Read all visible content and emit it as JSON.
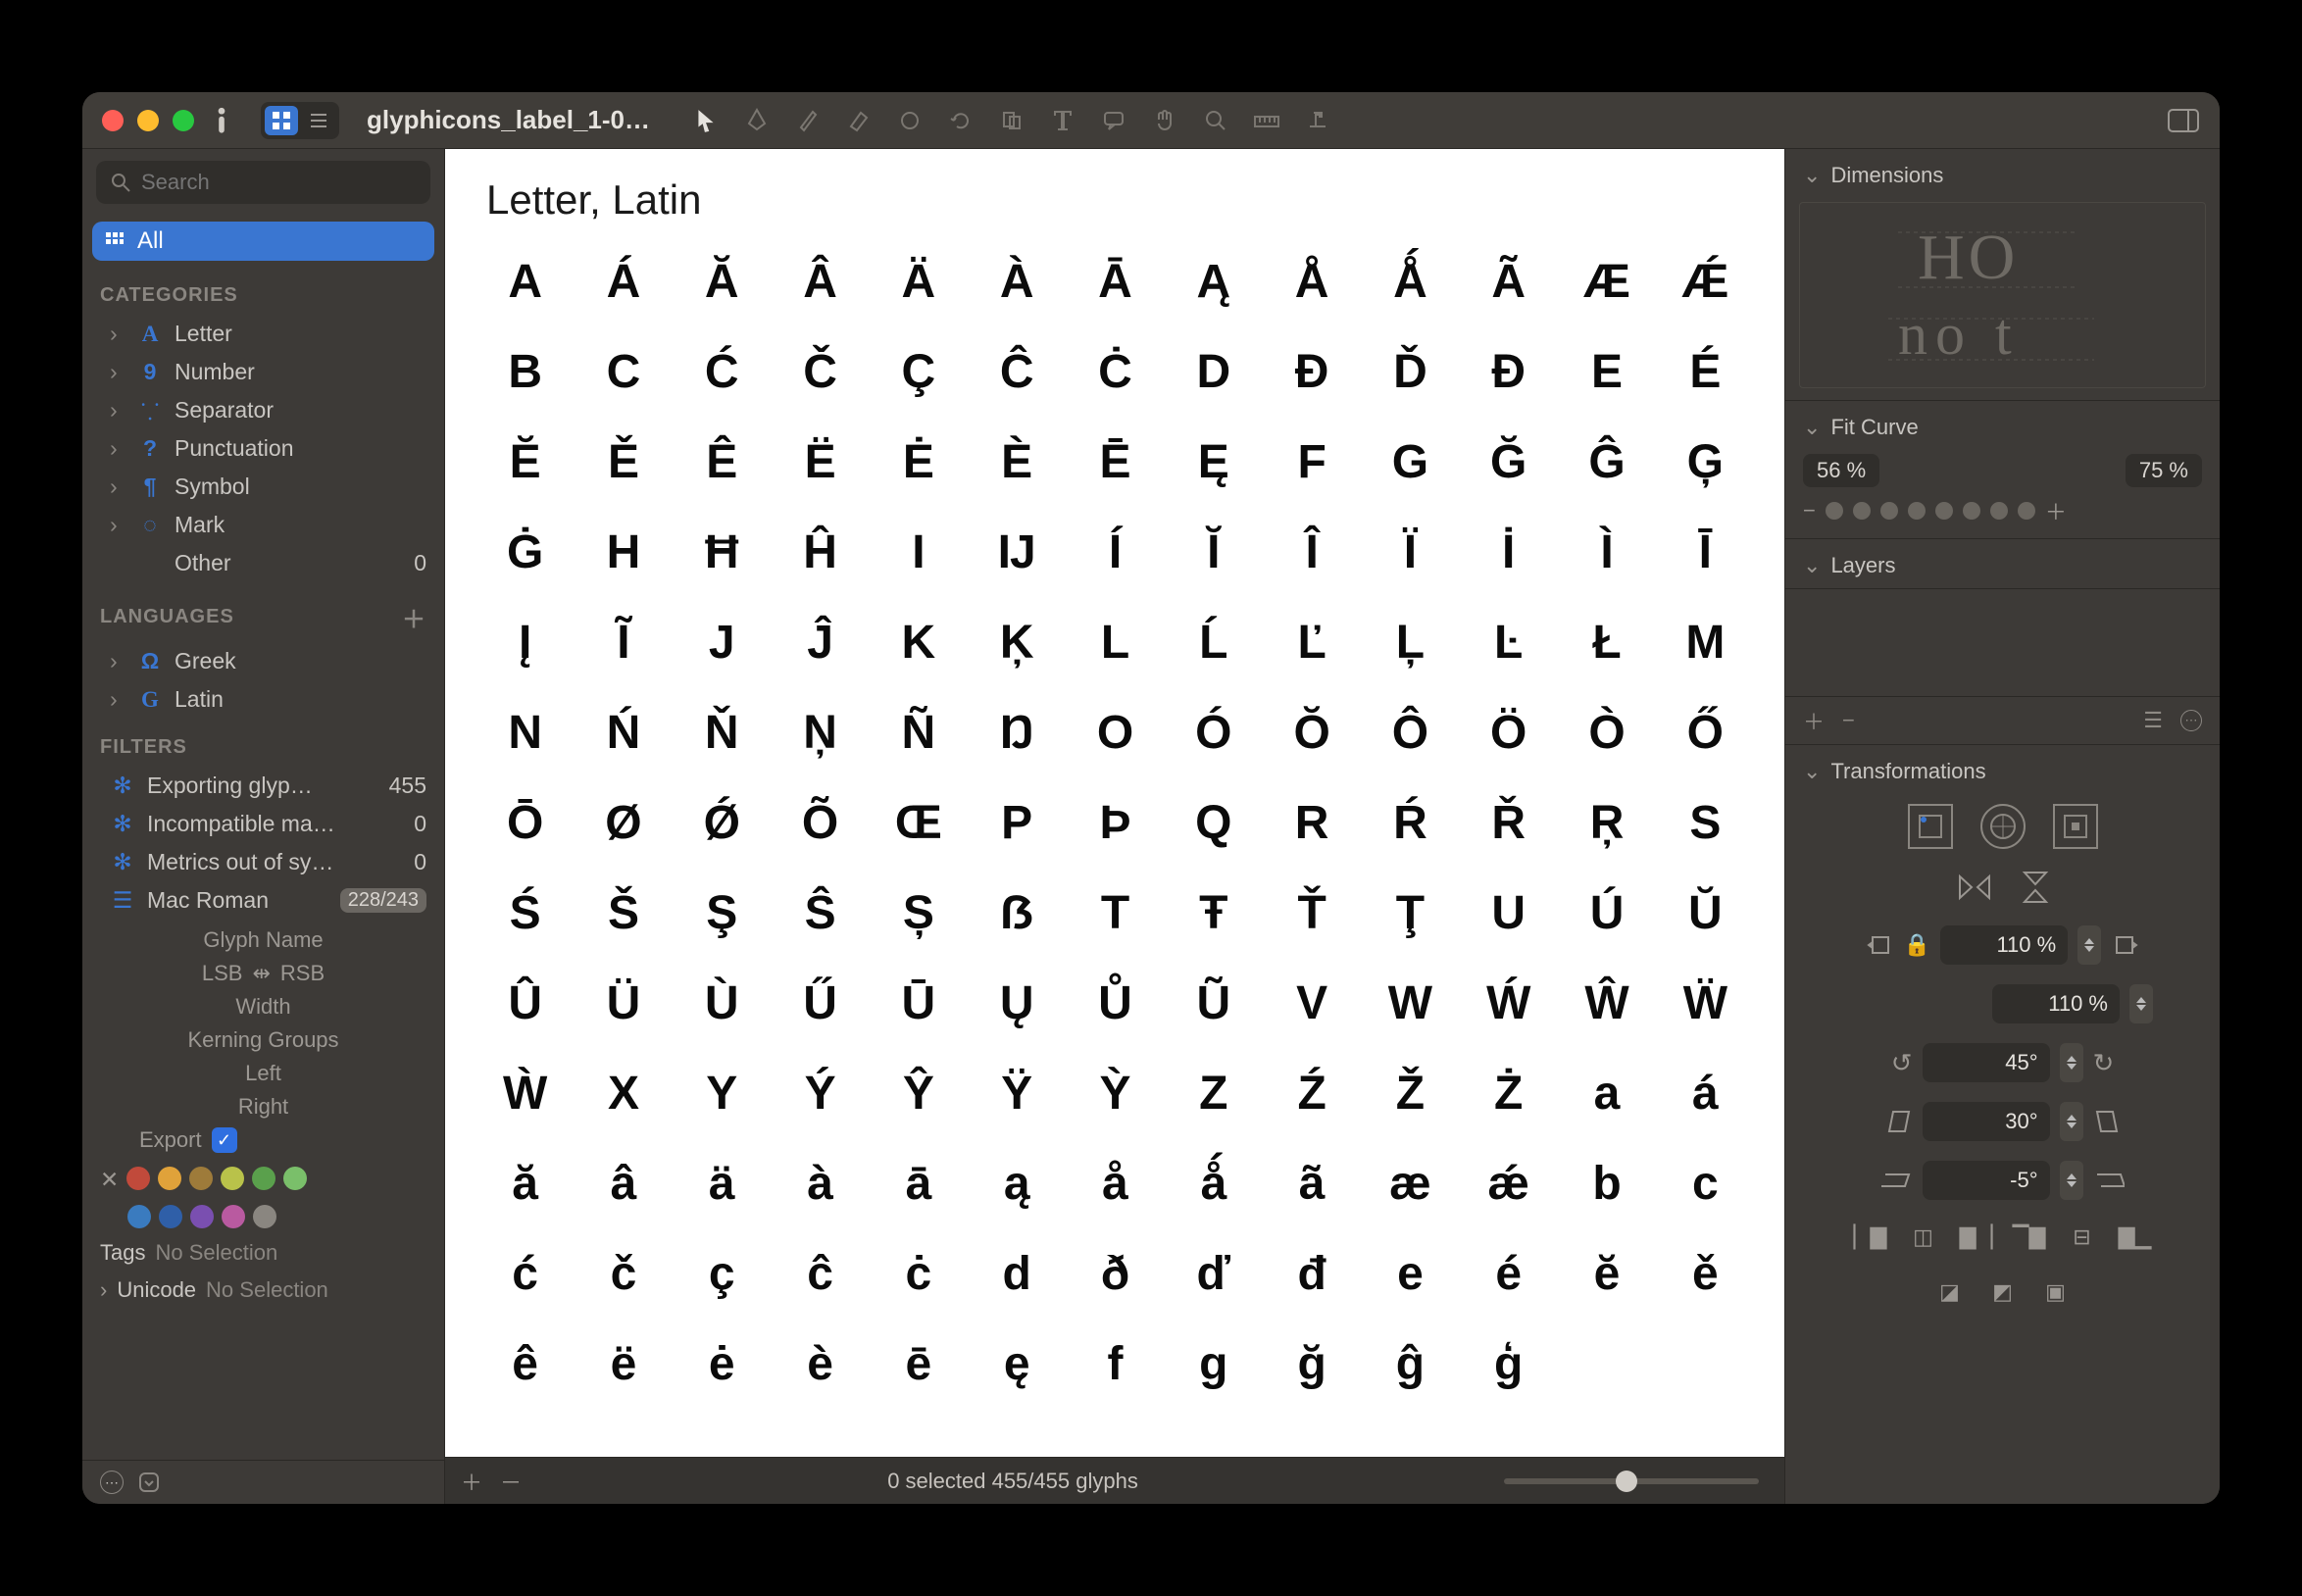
{
  "window": {
    "title": "glyphicons_label_1-0…"
  },
  "toolbar": {
    "view_mode": "grid",
    "tools": [
      "pointer",
      "pen",
      "pencil",
      "erase",
      "circle",
      "rotate",
      "crop",
      "text",
      "annotate",
      "hand",
      "zoom",
      "measure",
      "baseline"
    ]
  },
  "search": {
    "placeholder": "Search"
  },
  "sidebar": {
    "all_label": "All",
    "categories_header": "CATEGORIES",
    "categories": [
      {
        "icon": "letter",
        "label": "Letter"
      },
      {
        "icon": "number",
        "label": "Number"
      },
      {
        "icon": "separator",
        "label": "Separator"
      },
      {
        "icon": "punctuation",
        "label": "Punctuation"
      },
      {
        "icon": "symbol",
        "label": "Symbol"
      },
      {
        "icon": "mark",
        "label": "Mark"
      }
    ],
    "other": {
      "label": "Other",
      "count": 0
    },
    "languages_header": "LANGUAGES",
    "languages": [
      {
        "icon": "Ω",
        "label": "Greek"
      },
      {
        "icon": "G",
        "label": "Latin"
      }
    ],
    "filters_header": "FILTERS",
    "filters": [
      {
        "label": "Exporting glyp…",
        "count": "455"
      },
      {
        "label": "Incompatible ma…",
        "count": "0"
      },
      {
        "label": "Metrics out of sy…",
        "count": "0"
      },
      {
        "label": "Mac Roman",
        "count": "228/243",
        "badge": true,
        "list_icon": true
      }
    ],
    "glyph_info": {
      "name": "Glyph Name",
      "lsb": "LSB",
      "rsb": "RSB",
      "width": "Width",
      "kerning": "Kerning Groups",
      "left": "Left",
      "right": "Right",
      "export": "Export",
      "export_checked": true
    },
    "swatches": [
      "#c14a3b",
      "#e0a23a",
      "#9e7b3a",
      "#b9c24a",
      "#5aa04c",
      "#7abf6a",
      "#3a7bbf",
      "#2f5fa8",
      "#7a4fb0",
      "#b95aa0",
      "#8a8680"
    ],
    "tags": {
      "label": "Tags",
      "value": "No Selection"
    },
    "unicode": {
      "label": "Unicode",
      "value": "No Selection"
    }
  },
  "main": {
    "section_title": "Letter, Latin",
    "glyphs": [
      "A",
      "Á",
      "Ă",
      "Â",
      "Ä",
      "À",
      "Ā",
      "Ą",
      "Å",
      "Ǻ",
      "Ã",
      "Æ",
      "Ǽ",
      "B",
      "C",
      "Ć",
      "Č",
      "Ç",
      "Ĉ",
      "Ċ",
      "D",
      "Ð",
      "Ď",
      "Đ",
      "E",
      "É",
      "Ĕ",
      "Ě",
      "Ê",
      "Ë",
      "Ė",
      "È",
      "Ē",
      "Ę",
      "F",
      "G",
      "Ğ",
      "Ĝ",
      "Ģ",
      "Ġ",
      "H",
      "Ħ",
      "Ĥ",
      "I",
      "IJ",
      "Í",
      "Ĭ",
      "Î",
      "Ï",
      "İ",
      "Ì",
      "Ī",
      "Į",
      "Ĩ",
      "J",
      "Ĵ",
      "K",
      "Ķ",
      "L",
      "Ĺ",
      "Ľ",
      "Ļ",
      "Ŀ",
      "Ł",
      "M",
      "N",
      "Ń",
      "Ň",
      "Ņ",
      "Ñ",
      "Ŋ",
      "O",
      "Ó",
      "Ŏ",
      "Ô",
      "Ö",
      "Ò",
      "Ő",
      "Ō",
      "Ø",
      "Ǿ",
      "Õ",
      "Œ",
      "P",
      "Þ",
      "Q",
      "R",
      "Ŕ",
      "Ř",
      "Ŗ",
      "S",
      "Ś",
      "Š",
      "Ş",
      "Ŝ",
      "Ș",
      "ẞ",
      "T",
      "Ŧ",
      "Ť",
      "Ţ",
      "U",
      "Ú",
      "Ŭ",
      "Û",
      "Ü",
      "Ù",
      "Ű",
      "Ū",
      "Ų",
      "Ů",
      "Ũ",
      "V",
      "W",
      "Ẃ",
      "Ŵ",
      "Ẅ",
      "Ẁ",
      "X",
      "Y",
      "Ý",
      "Ŷ",
      "Ÿ",
      "Ỳ",
      "Z",
      "Ź",
      "Ž",
      "Ż",
      "a",
      "á",
      "ă",
      "â",
      "ä",
      "à",
      "ā",
      "ą",
      "å",
      "ǻ",
      "ã",
      "æ",
      "ǽ",
      "b",
      "c",
      "ć",
      "č",
      "ç",
      "ĉ",
      "ċ",
      "d",
      "ð",
      "ď",
      "đ",
      "e",
      "é",
      "ĕ",
      "ě",
      "ê",
      "ë",
      "ė",
      "è",
      "ē",
      "ę",
      "f",
      "g",
      "ğ",
      "ĝ",
      "ģ"
    ]
  },
  "statusbar": {
    "text": "0 selected 455/455 glyphs",
    "zoom_pos": 0.48
  },
  "inspector": {
    "dimensions": {
      "header": "Dimensions",
      "sample_top": "HO",
      "sample_bot": "no t"
    },
    "fit": {
      "header": "Fit Curve",
      "low": "56 %",
      "high": "75 %"
    },
    "layers": {
      "header": "Layers"
    },
    "transformations": {
      "header": "Transformations",
      "scale_h": "110 %",
      "scale_v": "110 %",
      "rotate": "45°",
      "skew": "30°",
      "slant": "-5°"
    }
  }
}
